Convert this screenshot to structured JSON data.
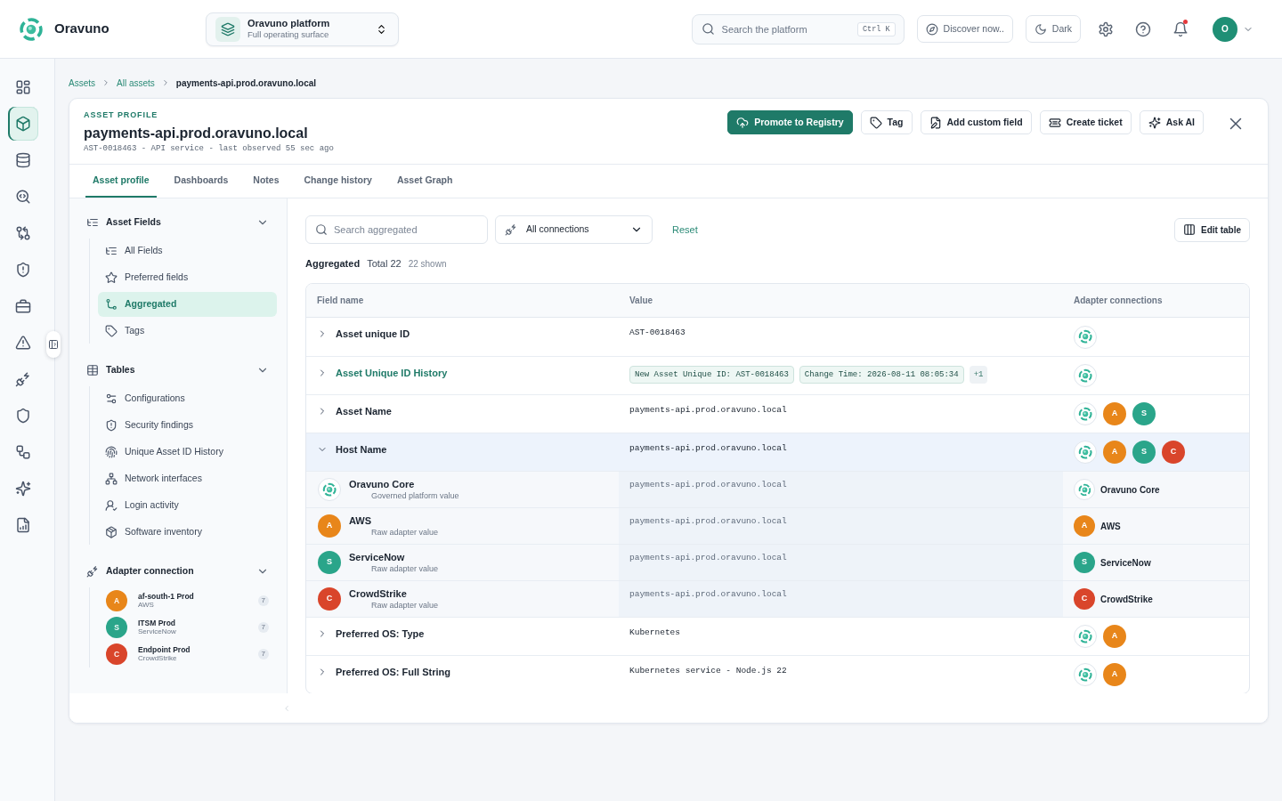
{
  "brand": {
    "name": "Oravuno"
  },
  "platform": {
    "title": "Oravuno platform",
    "subtitle": "Full operating surface"
  },
  "search": {
    "placeholder": "Search the platform",
    "shortcut": "Ctrl K"
  },
  "top_buttons": [
    {
      "label": "Discover now.."
    },
    {
      "label": "Dark"
    }
  ],
  "notifications": {
    "unread": true
  },
  "user": {
    "initial": "O"
  },
  "rail": [
    {
      "selected": false
    },
    {
      "selected": true
    },
    {
      "selected": false
    },
    {
      "selected": false
    },
    {
      "selected": false
    },
    {
      "selected": false
    },
    {
      "selected": false
    },
    {
      "selected": false
    },
    {
      "selected": false
    },
    {
      "selected": false
    },
    {
      "selected": false
    },
    {
      "selected": false
    },
    {
      "selected": false
    }
  ],
  "breadcrumb": [
    {
      "label": "Assets"
    },
    {
      "label": "All assets"
    },
    {
      "label": "payments-api.prod.oravuno.local"
    }
  ],
  "asset": {
    "eyebrow": "ASSET PROFILE",
    "title": "payments-api.prod.oravuno.local",
    "meta": "AST-0018463 - API service - last observed 55 sec ago"
  },
  "actions": [
    {
      "label": "Promote to Registry",
      "kind": "primary"
    },
    {
      "label": "Tag",
      "kind": "outline"
    },
    {
      "label": "Add custom field",
      "kind": "outline"
    },
    {
      "label": "Create ticket",
      "kind": "outline"
    },
    {
      "label": "Ask AI",
      "kind": "outline"
    }
  ],
  "tabs": [
    {
      "label": "Asset profile",
      "selected": true
    },
    {
      "label": "Dashboards",
      "selected": false
    },
    {
      "label": "Notes",
      "selected": false
    },
    {
      "label": "Change history",
      "selected": false
    },
    {
      "label": "Asset Graph",
      "selected": false
    }
  ],
  "field_nav": [
    {
      "title": "Asset Fields",
      "expanded": true,
      "items": [
        {
          "label": "All Fields",
          "selected": false
        },
        {
          "label": "Preferred fields",
          "selected": false
        },
        {
          "label": "Aggregated",
          "selected": true
        },
        {
          "label": "Tags",
          "selected": false
        }
      ]
    },
    {
      "title": "Tables",
      "expanded": true,
      "items": [
        {
          "label": "Configurations",
          "selected": false
        },
        {
          "label": "Security findings",
          "selected": false
        },
        {
          "label": "Unique Asset ID History",
          "selected": false
        },
        {
          "label": "Network interfaces",
          "selected": false
        },
        {
          "label": "Login activity",
          "selected": false
        },
        {
          "label": "Software inventory",
          "selected": false
        }
      ]
    },
    {
      "title": "Adapter connection",
      "expanded": true,
      "connections": [
        {
          "name": "af-south-1 Prod",
          "adapter": "AWS",
          "initial": "A",
          "color": "#e8861a",
          "count": "7"
        },
        {
          "name": "ITSM Prod",
          "adapter": "ServiceNow",
          "initial": "S",
          "color": "#2aa58a",
          "count": "7"
        },
        {
          "name": "Endpoint Prod",
          "adapter": "CrowdStrike",
          "initial": "C",
          "color": "#d9452b",
          "count": "7"
        }
      ]
    }
  ],
  "toolbar": {
    "search_placeholder": "Search aggregated",
    "connection_filter": "All connections",
    "reset": "Reset",
    "edit_table": "Edit table"
  },
  "summary": {
    "title": "Aggregated",
    "total": "Total 22",
    "shown": "22 shown"
  },
  "table": {
    "columns": [
      "Field name",
      "Value",
      "Adapter connections"
    ],
    "rows": [
      {
        "field": "Asset unique ID",
        "expanded": false,
        "linked": false,
        "value": "AST-0018463",
        "adapters": [
          {
            "kind": "core"
          }
        ]
      },
      {
        "field": "Asset Unique ID History",
        "expanded": false,
        "linked": true,
        "chips": [
          "New Asset Unique ID: AST-0018463",
          "Change Time: 2026-08-11 08:05:34"
        ],
        "more": "+1",
        "adapters": [
          {
            "kind": "core"
          }
        ]
      },
      {
        "field": "Asset Name",
        "expanded": false,
        "linked": false,
        "value": "payments-api.prod.oravuno.local",
        "adapters": [
          {
            "kind": "core"
          },
          {
            "kind": "letter",
            "initial": "A",
            "color": "#e8861a"
          },
          {
            "kind": "letter",
            "initial": "S",
            "color": "#2aa58a"
          }
        ]
      },
      {
        "field": "Host Name",
        "expanded": true,
        "linked": false,
        "value": "payments-api.prod.oravuno.local",
        "adapters": [
          {
            "kind": "core"
          },
          {
            "kind": "letter",
            "initial": "A",
            "color": "#e8861a"
          },
          {
            "kind": "letter",
            "initial": "S",
            "color": "#2aa58a"
          },
          {
            "kind": "letter",
            "initial": "C",
            "color": "#d9452b"
          }
        ],
        "sources": [
          {
            "name": "Oravuno Core",
            "note": "Governed platform value",
            "badge": {
              "kind": "core"
            },
            "value": "payments-api.prod.oravuno.local",
            "adapter": {
              "kind": "core",
              "label": "Oravuno Core"
            }
          },
          {
            "name": "AWS",
            "note": "Raw adapter value",
            "badge": {
              "kind": "letter",
              "initial": "A",
              "color": "#e8861a"
            },
            "value": "payments-api.prod.oravuno.local",
            "adapter": {
              "kind": "letter",
              "initial": "A",
              "color": "#e8861a",
              "label": "AWS"
            }
          },
          {
            "name": "ServiceNow",
            "note": "Raw adapter value",
            "badge": {
              "kind": "letter",
              "initial": "S",
              "color": "#2aa58a"
            },
            "value": "payments-api.prod.oravuno.local",
            "adapter": {
              "kind": "letter",
              "initial": "S",
              "color": "#2aa58a",
              "label": "ServiceNow"
            }
          },
          {
            "name": "CrowdStrike",
            "note": "Raw adapter value",
            "badge": {
              "kind": "letter",
              "initial": "C",
              "color": "#d9452b"
            },
            "value": "payments-api.prod.oravuno.local",
            "adapter": {
              "kind": "letter",
              "initial": "C",
              "color": "#d9452b",
              "label": "CrowdStrike"
            }
          }
        ]
      },
      {
        "field": "Preferred OS: Type",
        "expanded": false,
        "linked": false,
        "value": "Kubernetes",
        "adapters": [
          {
            "kind": "core"
          },
          {
            "kind": "letter",
            "initial": "A",
            "color": "#e8861a"
          }
        ]
      },
      {
        "field": "Preferred OS: Full String",
        "expanded": false,
        "linked": false,
        "value": "Kubernetes service - Node.js 22",
        "adapters": [
          {
            "kind": "core"
          },
          {
            "kind": "letter",
            "initial": "A",
            "color": "#e8861a"
          }
        ]
      }
    ]
  }
}
